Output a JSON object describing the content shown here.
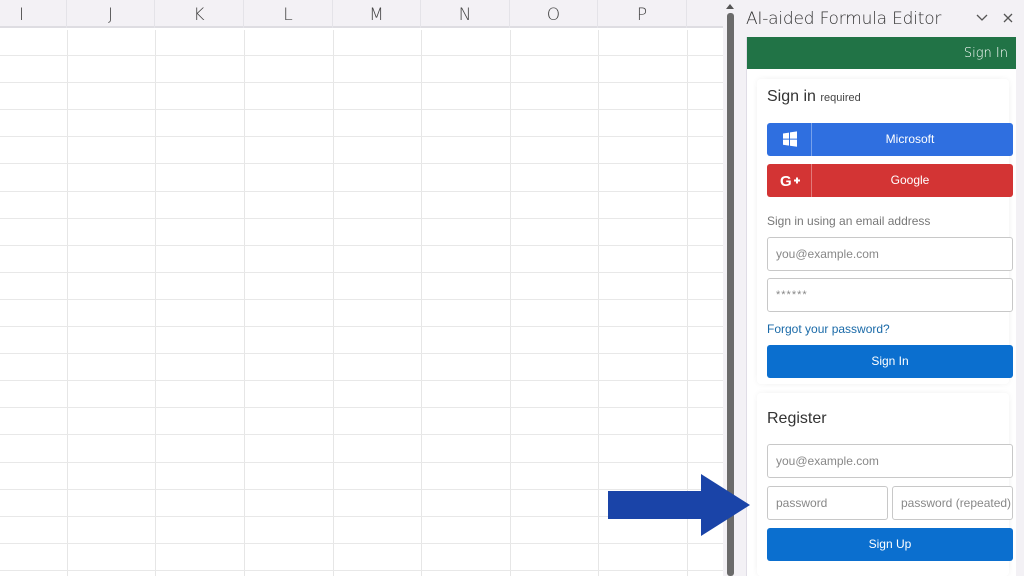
{
  "spreadsheet": {
    "columns": [
      "I",
      "J",
      "K",
      "L",
      "M",
      "N",
      "O",
      "P"
    ]
  },
  "pane": {
    "title": "AI-aided Formula Editor",
    "collapse_icon": "chevron-down-icon",
    "close_icon": "close-icon",
    "top_bar_signin": "Sign In",
    "accent_color": "#217346",
    "signin": {
      "title": "Sign in",
      "title_note": "required",
      "microsoft_label": "Microsoft",
      "microsoft_icon": "windows-logo-icon",
      "google_label": "Google",
      "google_icon": "google-plus-icon",
      "email_hint": "Sign in using an email address",
      "email_placeholder": "you@example.com",
      "password_value": "******",
      "forgot_link": "Forgot your password?",
      "submit_label": "Sign In"
    },
    "register": {
      "title": "Register",
      "email_placeholder": "you@example.com",
      "password_placeholder": "password",
      "password_repeat_placeholder": "password (repeated)",
      "submit_label": "Sign Up"
    }
  },
  "annotation": {
    "arrow_icon": "arrow-right-icon",
    "arrow_color": "#1a44a8"
  }
}
